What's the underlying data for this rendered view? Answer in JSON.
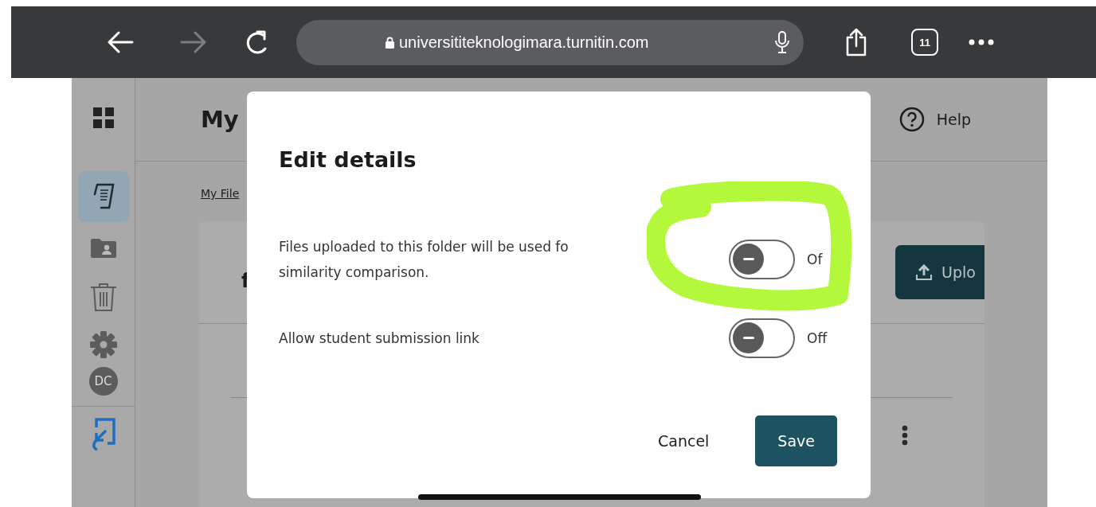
{
  "browser": {
    "url": "universititeknologimara.turnitin.com",
    "tab_count": "11",
    "forward_disabled": true
  },
  "sidebar": {
    "items": [
      {
        "kind": "apps",
        "selected": false
      },
      {
        "kind": "files",
        "selected": true
      },
      {
        "kind": "shared",
        "selected": false
      },
      {
        "kind": "trash",
        "selected": false
      },
      {
        "kind": "settings",
        "selected": false
      }
    ],
    "avatar": "DC",
    "bottom_item": {
      "kind": "switch"
    }
  },
  "page": {
    "title": "My",
    "help": "Help",
    "breadcrumb": "My File",
    "card_title_fragment": "f",
    "upload_button": "Uplo"
  },
  "dialog": {
    "title": "Edit details",
    "settings": [
      {
        "label": "Files uploaded to this folder will be used fo\nsimilarity comparison.",
        "on": false,
        "state_text": "Of"
      },
      {
        "label": "Allow student submission link",
        "on": false,
        "state_text": "Off"
      }
    ],
    "buttons": [
      {
        "label": "Cancel",
        "kind": "secondary"
      },
      {
        "label": "Save",
        "kind": "primary"
      }
    ]
  }
}
